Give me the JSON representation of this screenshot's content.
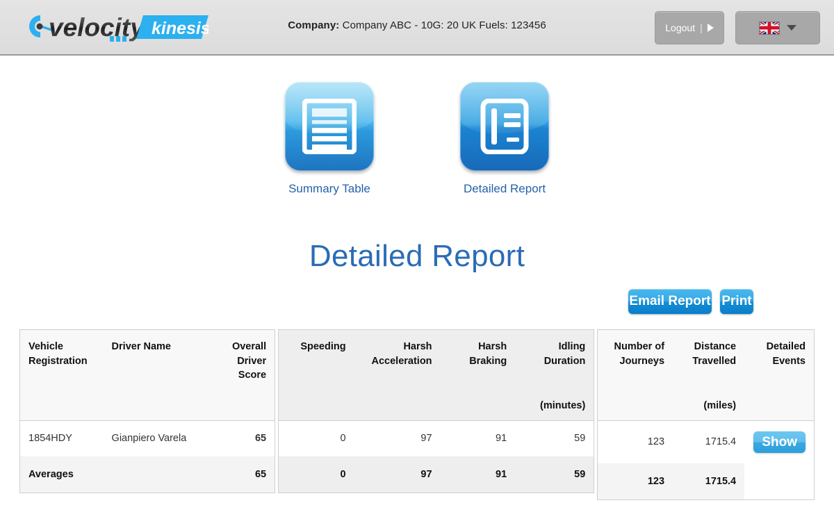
{
  "header": {
    "logo": {
      "brand": "velocity",
      "product": "kinesis",
      "gauge_icon": "speedometer-icon"
    },
    "company_label": "Company:",
    "company_value": "Company ABC - 10G: 20 UK Fuels: 123456",
    "logout_label": "Logout",
    "logout_separator": "|",
    "logout_arrow_icon": "play-triangle-icon",
    "language_flag_icon": "uk-flag-icon",
    "language_chevron_icon": "chevron-down-icon",
    "bg_color": "#e0e0e0",
    "border_color": "#9a9a9a"
  },
  "icon_nav": [
    {
      "label": "Summary Table",
      "icon": "summary-table-icon"
    },
    {
      "label": "Detailed Report",
      "icon": "detailed-report-icon"
    }
  ],
  "page": {
    "title": "Detailed Report",
    "title_color": "#2a6cb5"
  },
  "actions": {
    "email_label": "Email Report",
    "print_label": "Print",
    "accent_color": "#1b8fd6"
  },
  "table": {
    "groups": [
      {
        "name": "driver-summary",
        "columns": [
          {
            "label": "Vehicle Registration",
            "align": "left",
            "unit": ""
          },
          {
            "label": "Driver Name",
            "align": "left",
            "unit": ""
          },
          {
            "label": "Overall Driver Score",
            "align": "right",
            "unit": ""
          }
        ],
        "rows": [
          {
            "cells": [
              "1854HDY",
              "Gianpiero Varela",
              "65"
            ],
            "bold": [
              false,
              false,
              true
            ]
          }
        ],
        "averages": {
          "label": "Averages",
          "cells": [
            "Averages",
            "",
            "65"
          ]
        }
      },
      {
        "name": "driving-events",
        "columns": [
          {
            "label": "Speeding",
            "align": "right",
            "unit": ""
          },
          {
            "label": "Harsh Acceleration",
            "align": "right",
            "unit": ""
          },
          {
            "label": "Harsh Braking",
            "align": "right",
            "unit": ""
          },
          {
            "label": "Idling Duration",
            "align": "right",
            "unit": "(minutes)"
          }
        ],
        "rows": [
          {
            "cells": [
              "0",
              "97",
              "91",
              "59"
            ]
          }
        ],
        "averages": {
          "cells": [
            "0",
            "97",
            "91",
            "59"
          ]
        }
      },
      {
        "name": "journey-totals",
        "columns": [
          {
            "label": "Number of Journeys",
            "align": "right",
            "unit": ""
          },
          {
            "label": "Distance Travelled",
            "align": "right",
            "unit": "(miles)"
          },
          {
            "label": "Detailed Events",
            "align": "right",
            "unit": ""
          }
        ],
        "rows": [
          {
            "cells": [
              "123",
              "1715.4"
            ],
            "action": "Show"
          }
        ],
        "averages": {
          "cells": [
            "123",
            "1715.4",
            ""
          ]
        }
      }
    ]
  }
}
